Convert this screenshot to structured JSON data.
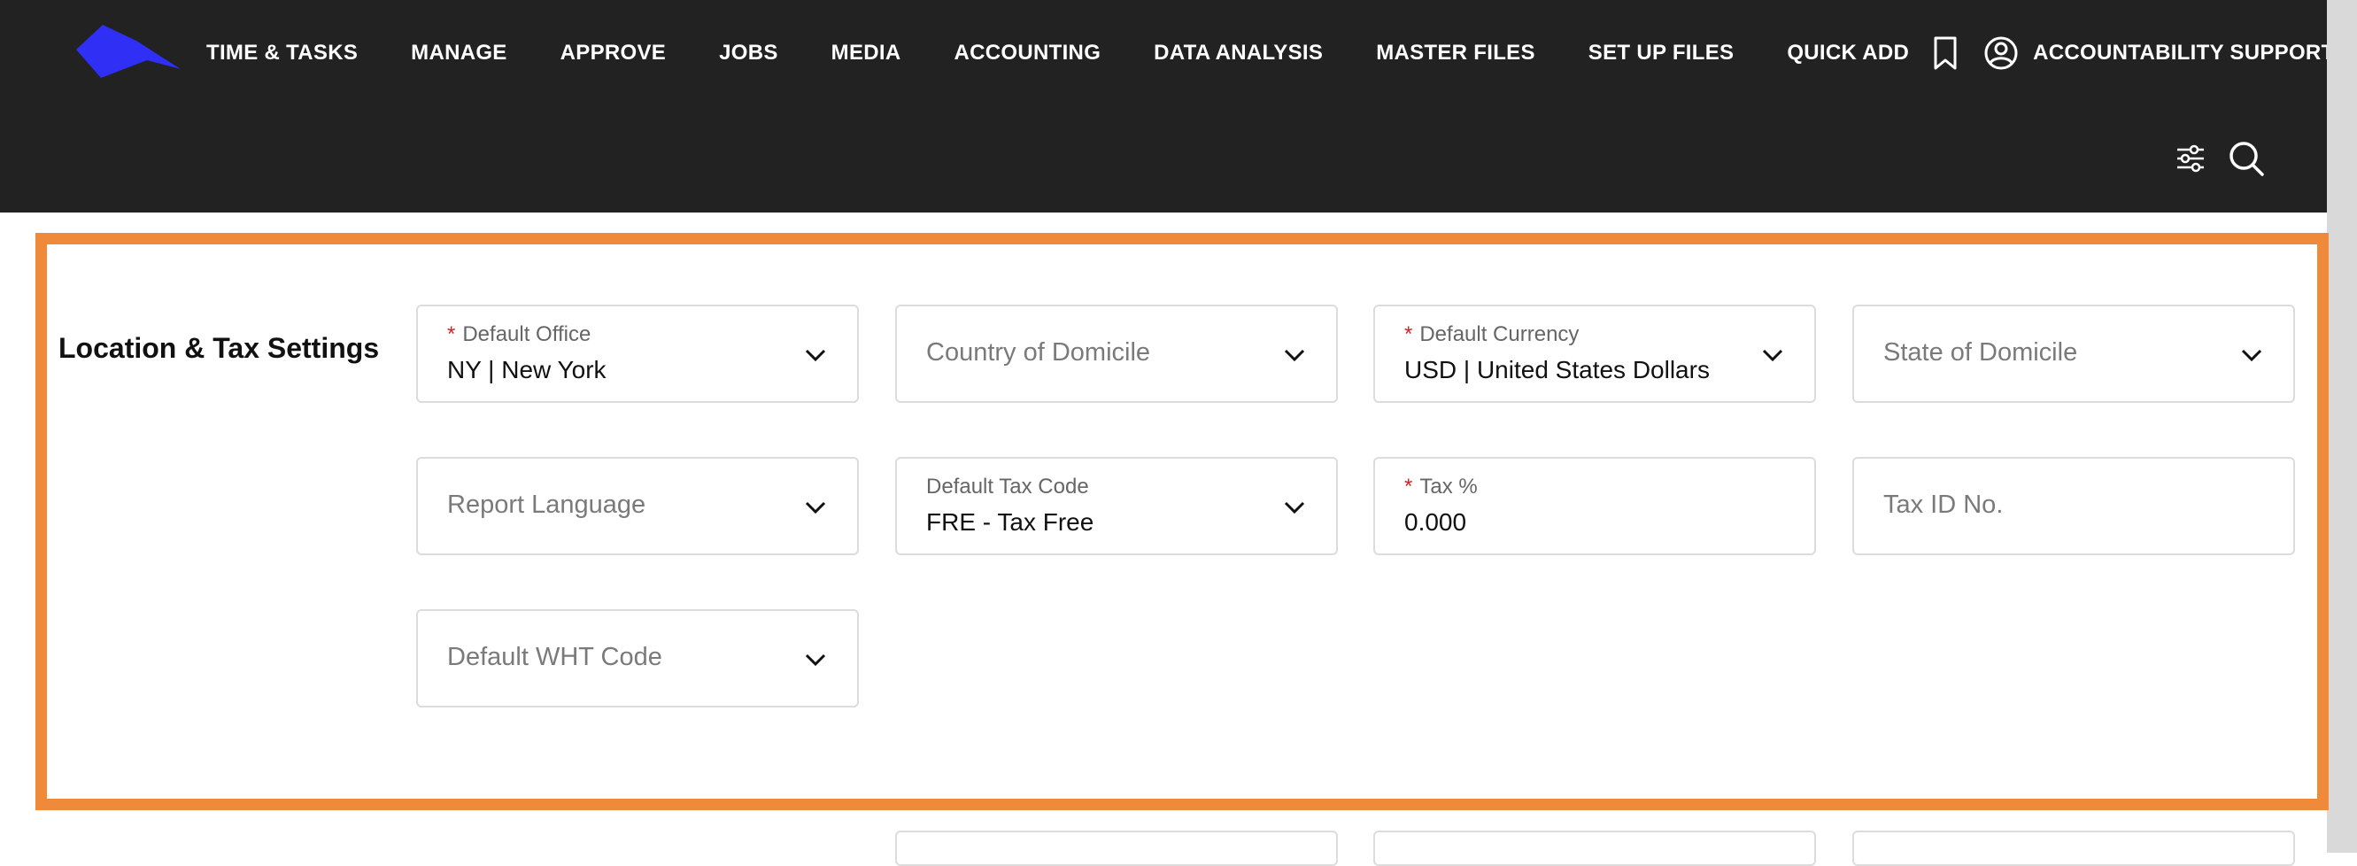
{
  "header": {
    "nav": [
      "TIME & TASKS",
      "MANAGE",
      "APPROVE",
      "JOBS",
      "MEDIA",
      "ACCOUNTING",
      "DATA ANALYSIS",
      "MASTER FILES",
      "SET UP FILES",
      "QUICK ADD"
    ],
    "user_name": "ACCOUNTABILITY SUPPORT",
    "icons": {
      "logo": "logo-icon",
      "bookmark": "bookmark-icon",
      "user": "user-circle-icon",
      "filters": "sliders-icon",
      "search": "search-icon"
    },
    "colors": {
      "bar": "#222222",
      "logo": "#2f2ff5"
    }
  },
  "section": {
    "title": "Location & Tax Settings",
    "highlight_color": "#ef8a3a",
    "fields": {
      "default_office": {
        "label": "Default Office",
        "required": "*",
        "value": "NY | New York"
      },
      "country_of_domicile": {
        "placeholder": "Country of Domicile"
      },
      "default_currency": {
        "label": "Default Currency",
        "required": "*",
        "value": "USD | United States Dollars"
      },
      "state_of_domicile": {
        "placeholder": "State of Domicile"
      },
      "report_language": {
        "placeholder": "Report Language"
      },
      "default_tax_code": {
        "label": "Default Tax Code",
        "value": "FRE - Tax Free"
      },
      "tax_percent": {
        "label": "Tax %",
        "required": "*",
        "value": "0.000"
      },
      "tax_id_no": {
        "placeholder": "Tax ID No."
      },
      "default_wht_code": {
        "placeholder": "Default WHT Code"
      }
    }
  }
}
